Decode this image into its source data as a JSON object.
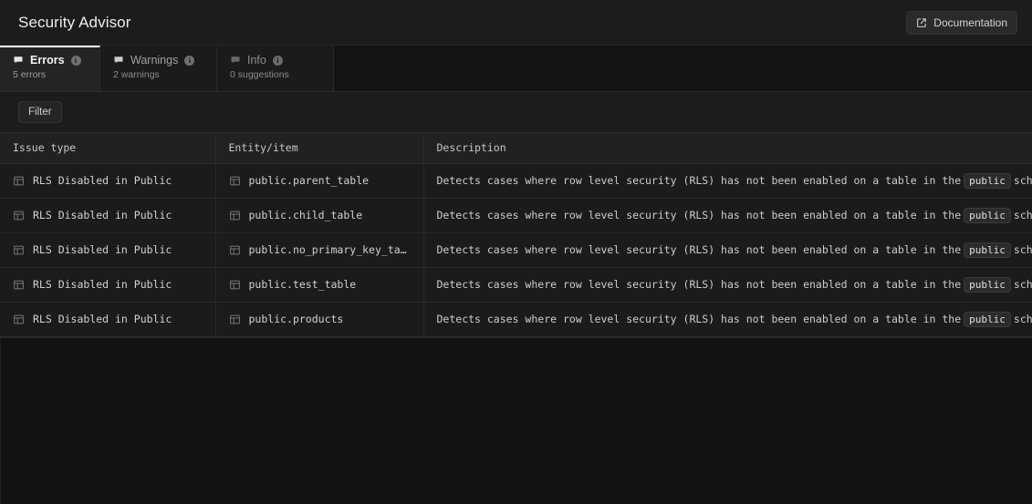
{
  "header": {
    "title": "Security Advisor",
    "documentation_button": {
      "label": "Documentation",
      "icon": "external-link-icon"
    }
  },
  "tabs": [
    {
      "id": "errors",
      "label": "Errors",
      "sublabel": "5 errors",
      "icon": "flag-icon",
      "info_icon": "info-circle-icon",
      "active": true
    },
    {
      "id": "warnings",
      "label": "Warnings",
      "sublabel": "2 warnings",
      "icon": "flag-icon",
      "info_icon": "info-circle-icon",
      "active": false
    },
    {
      "id": "info",
      "label": "Info",
      "sublabel": "0 suggestions",
      "icon": "flag-icon",
      "info_icon": "info-circle-icon",
      "active": false
    }
  ],
  "toolbar": {
    "filter_label": "Filter"
  },
  "table": {
    "columns": [
      "Issue type",
      "Entity/item",
      "Description"
    ],
    "rows": [
      {
        "issue_type": "RLS Disabled in Public",
        "entity": "public.parent_table",
        "description_before": "Detects cases where row level security (RLS) has not been enabled on a table in the",
        "description_code": "public",
        "description_after": "schema.",
        "issue_icon": "table-grid-icon",
        "entity_icon": "table-grid-icon"
      },
      {
        "issue_type": "RLS Disabled in Public",
        "entity": "public.child_table",
        "description_before": "Detects cases where row level security (RLS) has not been enabled on a table in the",
        "description_code": "public",
        "description_after": "schema.",
        "issue_icon": "table-grid-icon",
        "entity_icon": "table-grid-icon"
      },
      {
        "issue_type": "RLS Disabled in Public",
        "entity": "public.no_primary_key_table",
        "description_before": "Detects cases where row level security (RLS) has not been enabled on a table in the",
        "description_code": "public",
        "description_after": "schema.",
        "issue_icon": "table-grid-icon",
        "entity_icon": "table-grid-icon"
      },
      {
        "issue_type": "RLS Disabled in Public",
        "entity": "public.test_table",
        "description_before": "Detects cases where row level security (RLS) has not been enabled on a table in the",
        "description_code": "public",
        "description_after": "schema.",
        "issue_icon": "table-grid-icon",
        "entity_icon": "table-grid-icon"
      },
      {
        "issue_type": "RLS Disabled in Public",
        "entity": "public.products",
        "description_before": "Detects cases where row level security (RLS) has not been enabled on a table in the",
        "description_code": "public",
        "description_after": "schema.",
        "issue_icon": "table-grid-icon",
        "entity_icon": "table-grid-icon"
      }
    ]
  },
  "colors": {
    "background": "#121212",
    "panel": "#1c1c1c",
    "row": "#1b1b1b",
    "header_row": "#212121",
    "active_tab": "#242424",
    "active_tab_indicator": "#ffffff",
    "border": "#2a2a2a",
    "text_primary": "#ededed",
    "text_secondary": "#8b8b8b"
  }
}
